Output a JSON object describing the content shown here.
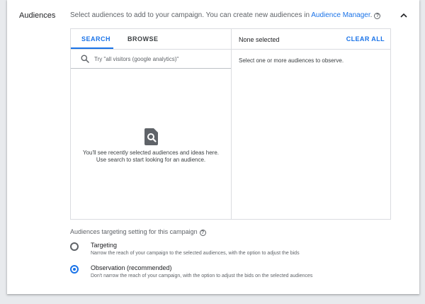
{
  "section": {
    "title": "Audiences",
    "description": "Select audiences to add to your campaign. You can create new audiences in ",
    "link_text": "Audience Manager",
    "description_end": "."
  },
  "picker": {
    "tabs": [
      {
        "label": "SEARCH",
        "active": true
      },
      {
        "label": "BROWSE",
        "active": false
      }
    ],
    "search_placeholder": "Try \"all visitors (google analytics)\"",
    "empty_line1": "You'll see recently selected audiences and ideas here.",
    "empty_line2": "Use search to start looking for an audience.",
    "selected_status": "None selected",
    "clear_all": "CLEAR ALL",
    "observe_hint": "Select one or more audiences to observe."
  },
  "targeting": {
    "label": "Audiences targeting setting for this campaign",
    "options": [
      {
        "title": "Targeting",
        "desc": "Narrow the reach of your campaign to the selected audiences, with the option to adjust the bids",
        "checked": false
      },
      {
        "title": "Observation (recommended)",
        "desc": "Don't narrow the reach of your campaign, with the option to adjust the bids on the selected audiences",
        "checked": true
      }
    ]
  },
  "icons": {
    "help": "help-icon",
    "collapse": "chevron-up-icon",
    "search": "search-icon",
    "empty_state": "document-search-icon"
  },
  "colors": {
    "accent": "#1a73e8",
    "background": "#e8eaed",
    "text_secondary": "#5f6368"
  }
}
